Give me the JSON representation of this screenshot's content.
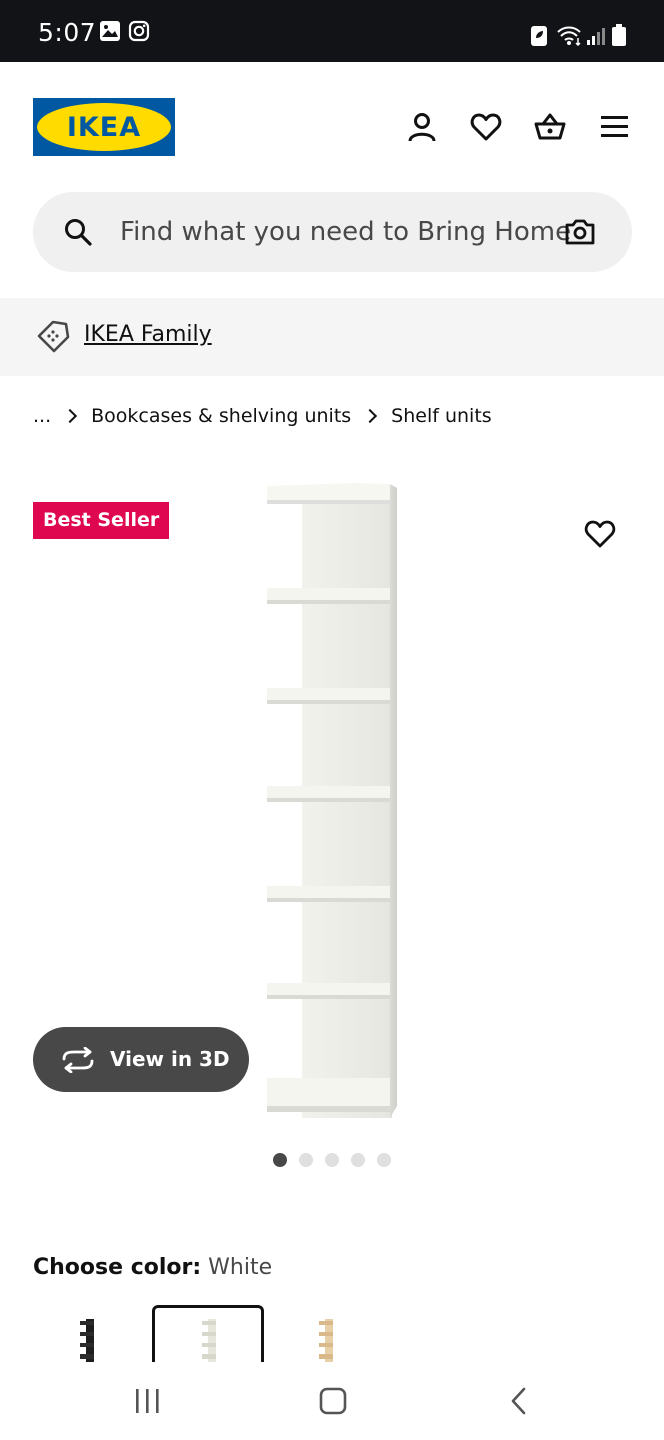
{
  "status_bar": {
    "time": "5:07",
    "left_icons": [
      "image-icon",
      "instagram-icon"
    ],
    "right_icons": [
      "battery-saver-icon",
      "wifi-icon",
      "signal-icon",
      "battery-icon"
    ]
  },
  "header": {
    "logo_text": "IKEA",
    "icons": [
      "account-icon",
      "wishlist-heart-icon",
      "shopping-basket-icon",
      "menu-icon"
    ],
    "colors": {
      "logo_blue": "#0058a3",
      "logo_yellow": "#ffdb00"
    }
  },
  "search": {
    "placeholder": "Find what you need to Bring Home"
  },
  "family": {
    "label": "IKEA Family"
  },
  "breadcrumb": {
    "items": [
      "...",
      "Bookcases & shelving units",
      "Shelf units"
    ]
  },
  "product": {
    "badge": "Best Seller",
    "badge_color": "#e00751",
    "view_3d_label": "View in 3D",
    "image_count": 5,
    "active_image": 1
  },
  "color_chooser": {
    "label": "Choose color:",
    "value": "White",
    "swatches": [
      "black-brown",
      "white",
      "white-stained-oak"
    ]
  }
}
